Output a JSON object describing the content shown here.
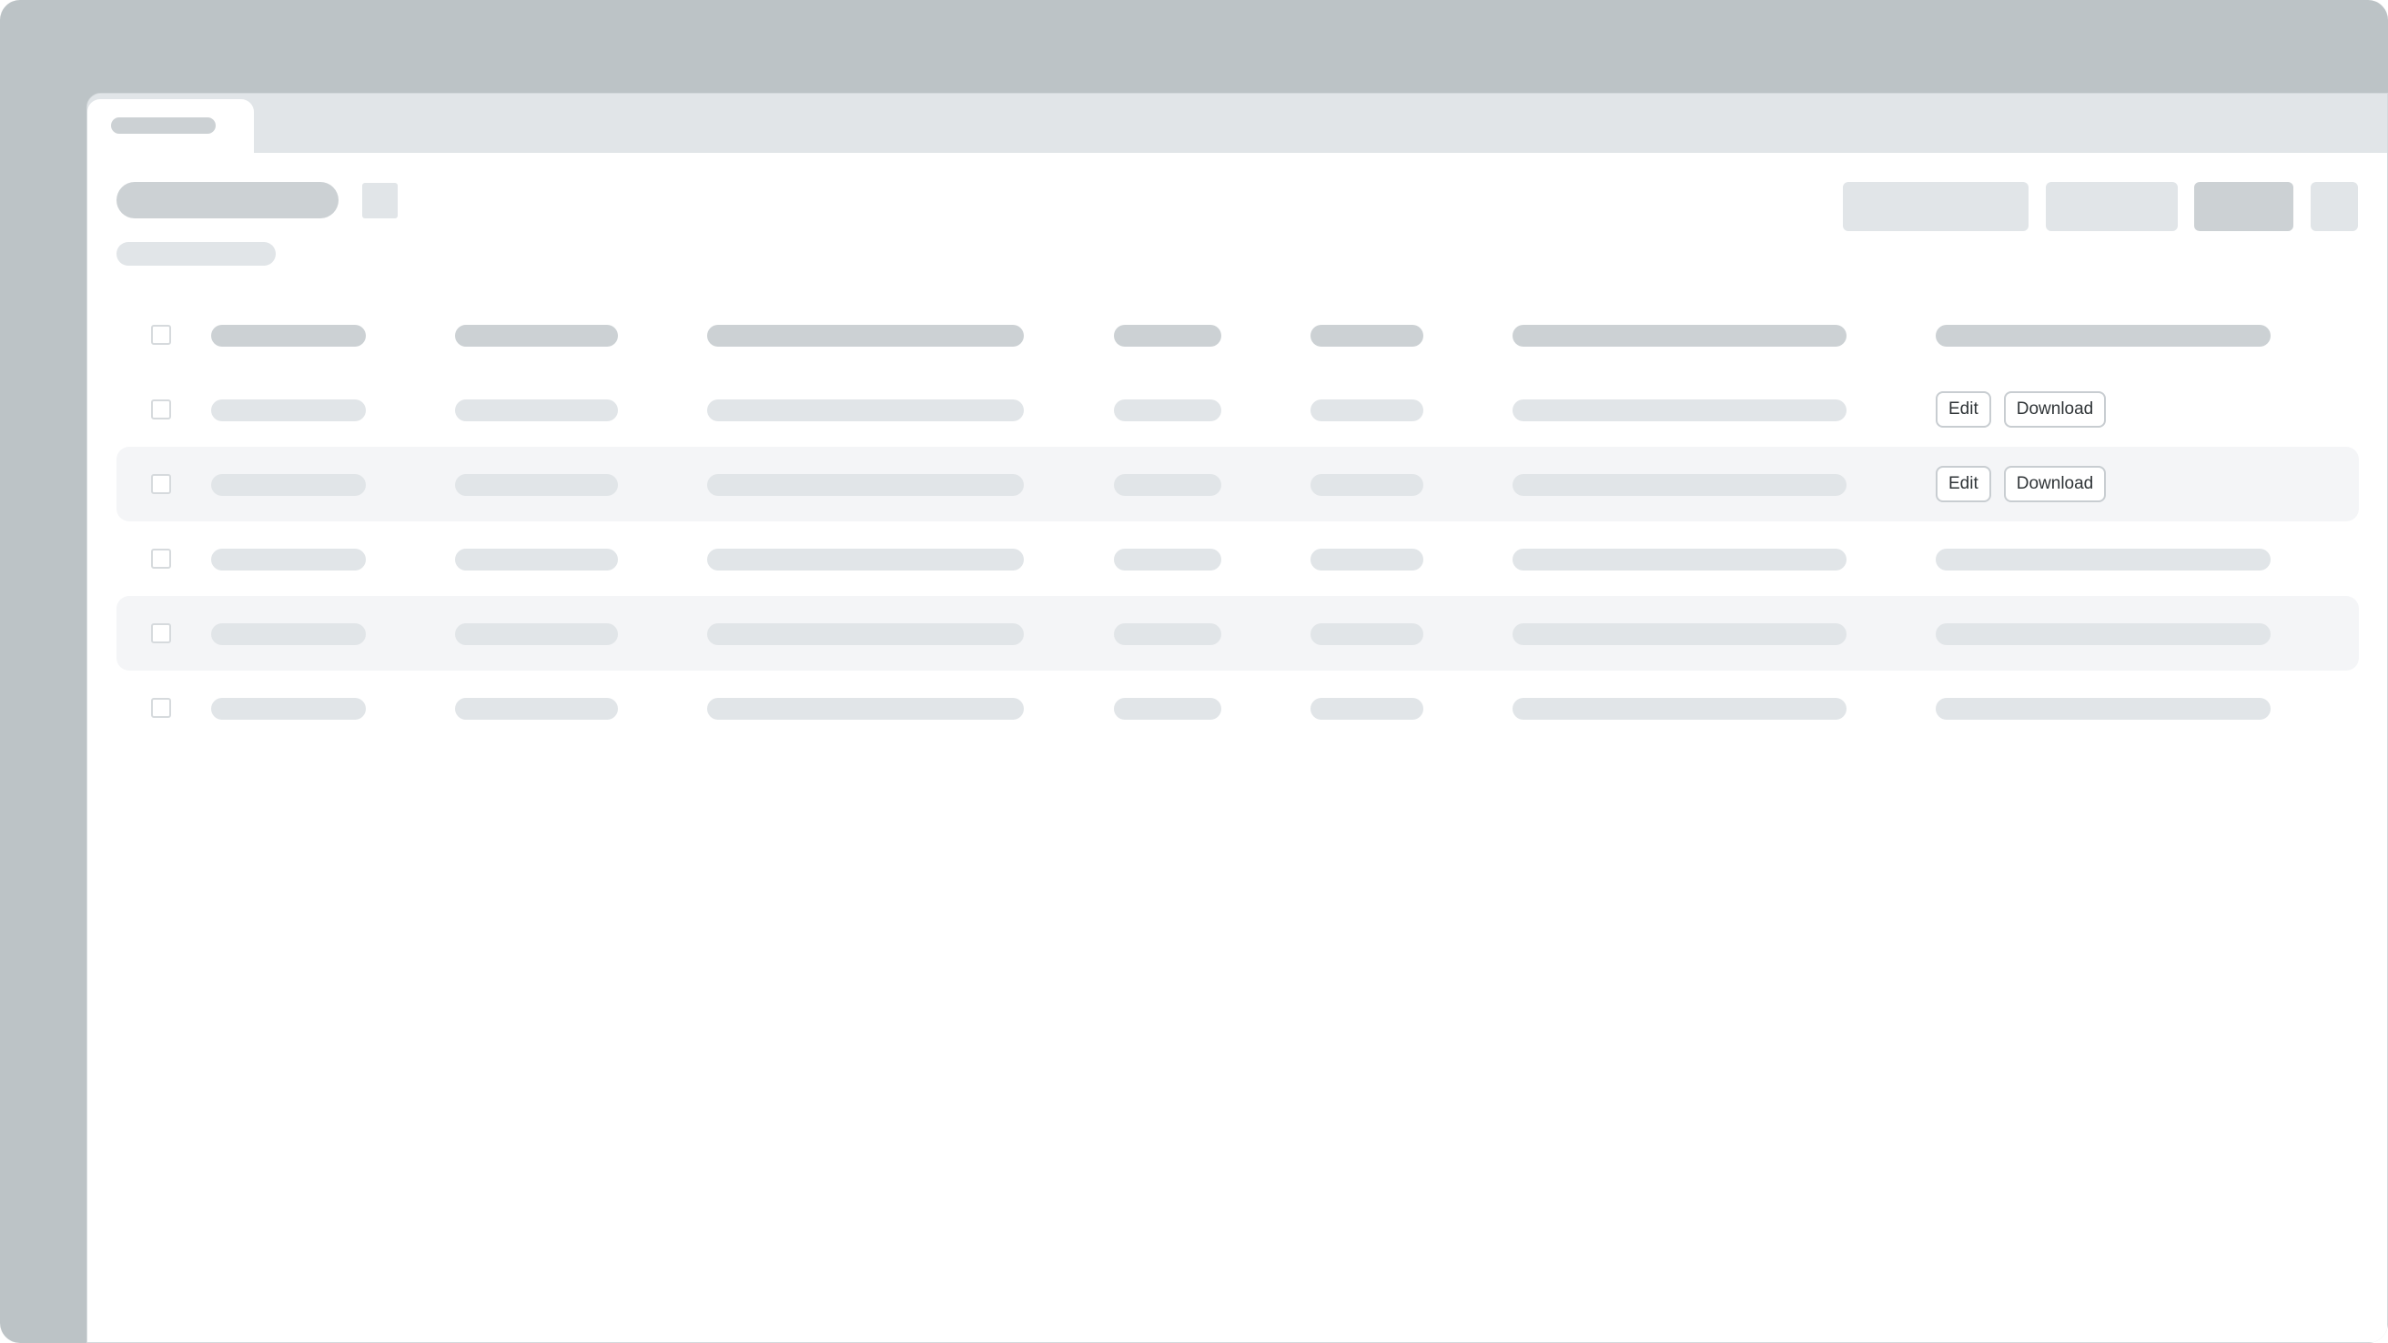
{
  "table": {
    "columns": 7,
    "rows": [
      {
        "striped": false,
        "actions": [
          "Edit",
          "Download"
        ]
      },
      {
        "striped": true,
        "actions": [
          "Edit",
          "Download"
        ]
      },
      {
        "striped": false,
        "actions": []
      },
      {
        "striped": true,
        "actions": []
      },
      {
        "striped": false,
        "actions": []
      }
    ],
    "edit_label": "Edit",
    "download_label": "Download"
  },
  "colors": {
    "frame": "#bcc3c6",
    "window": "#ffffff",
    "skeleton_dark": "#ccd1d4",
    "skeleton_light": "#e1e5e8",
    "row_stripe": "#f4f5f7"
  }
}
